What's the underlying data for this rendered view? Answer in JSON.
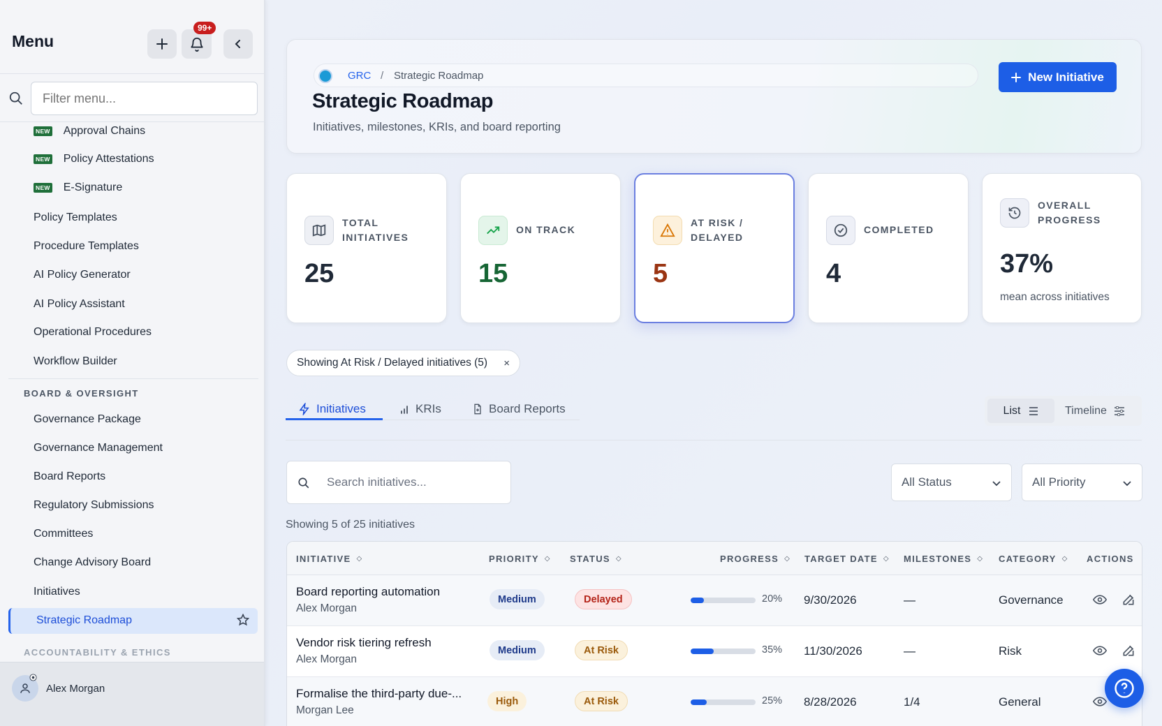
{
  "sidebar": {
    "title": "Menu",
    "notifications_badge": "99+",
    "filter_placeholder": "Filter menu...",
    "new_tag": "NEW",
    "items_new": [
      {
        "label": "Approval Chains"
      },
      {
        "label": "Policy Attestations"
      },
      {
        "label": "E-Signature"
      }
    ],
    "items": [
      {
        "label": "Policy Templates"
      },
      {
        "label": "Procedure Templates"
      },
      {
        "label": "AI Policy Generator"
      },
      {
        "label": "AI Policy Assistant"
      },
      {
        "label": "Operational Procedures"
      },
      {
        "label": "Workflow Builder"
      }
    ],
    "section_board": "BOARD & OVERSIGHT",
    "board_items": [
      {
        "label": "Governance Package"
      },
      {
        "label": "Governance Management"
      },
      {
        "label": "Board Reports"
      },
      {
        "label": "Regulatory Submissions"
      },
      {
        "label": "Committees"
      },
      {
        "label": "Change Advisory Board"
      },
      {
        "label": "Initiatives"
      }
    ],
    "active_item": "Strategic Roadmap",
    "section_accountability": "ACCOUNTABILITY & ETHICS",
    "user_name": "Alex Morgan"
  },
  "header": {
    "breadcrumb_root": "GRC",
    "breadcrumb_sep": "/",
    "breadcrumb_current": "Strategic Roadmap",
    "title": "Strategic Roadmap",
    "subtitle": "Initiatives, milestones, KRIs, and board reporting",
    "new_button": "New Initiative"
  },
  "stats": [
    {
      "label": "TOTAL INITIATIVES",
      "value": "25",
      "icon": "map-icon",
      "color": "#1f2937"
    },
    {
      "label": "ON TRACK",
      "value": "15",
      "icon": "trending-up-icon",
      "color": "#166534"
    },
    {
      "label": "AT RISK / DELAYED",
      "value": "5",
      "icon": "warning-icon",
      "color": "#9a3412"
    },
    {
      "label": "COMPLETED",
      "value": "4",
      "icon": "check-circle-icon",
      "color": "#1f2937"
    },
    {
      "label": "OVERALL PROGRESS",
      "value": "37%",
      "sub": "mean across initiatives",
      "icon": "history-icon",
      "color": "#1f2937"
    }
  ],
  "filter_chip": {
    "label": "Showing At Risk / Delayed initiatives (5)",
    "close": "×"
  },
  "tabs": [
    {
      "label": "Initiatives",
      "active": true
    },
    {
      "label": "KRIs"
    },
    {
      "label": "Board Reports"
    }
  ],
  "view_toggle": {
    "list": "List",
    "timeline": "Timeline"
  },
  "search": {
    "placeholder": "Search initiatives..."
  },
  "filters": {
    "status": "All Status",
    "priority": "All Priority"
  },
  "showing_text": "Showing 5 of 25 initiatives",
  "table": {
    "columns": [
      "INITIATIVE",
      "PRIORITY",
      "STATUS",
      "PROGRESS",
      "TARGET DATE",
      "MILESTONES",
      "CATEGORY",
      "ACTIONS"
    ],
    "rows": [
      {
        "name": "Board reporting automation",
        "owner": "Alex Morgan",
        "priority": "Medium",
        "status": "Delayed",
        "progress": 20,
        "progress_label": "20%",
        "target": "9/30/2026",
        "milestones": "—",
        "category": "Governance"
      },
      {
        "name": "Vendor risk tiering refresh",
        "owner": "Alex Morgan",
        "priority": "Medium",
        "status": "At Risk",
        "progress": 35,
        "progress_label": "35%",
        "target": "11/30/2026",
        "milestones": "—",
        "category": "Risk"
      },
      {
        "name": "Formalise the third-party due-...",
        "owner": "Morgan Lee",
        "priority": "High",
        "status": "At Risk",
        "progress": 25,
        "progress_label": "25%",
        "target": "8/28/2026",
        "milestones": "1/4",
        "category": "General"
      }
    ]
  },
  "colors": {
    "accent": "#1d5ee6",
    "delayed": "#b42318",
    "at_risk": "#9a5a0b",
    "on_track": "#166534"
  }
}
